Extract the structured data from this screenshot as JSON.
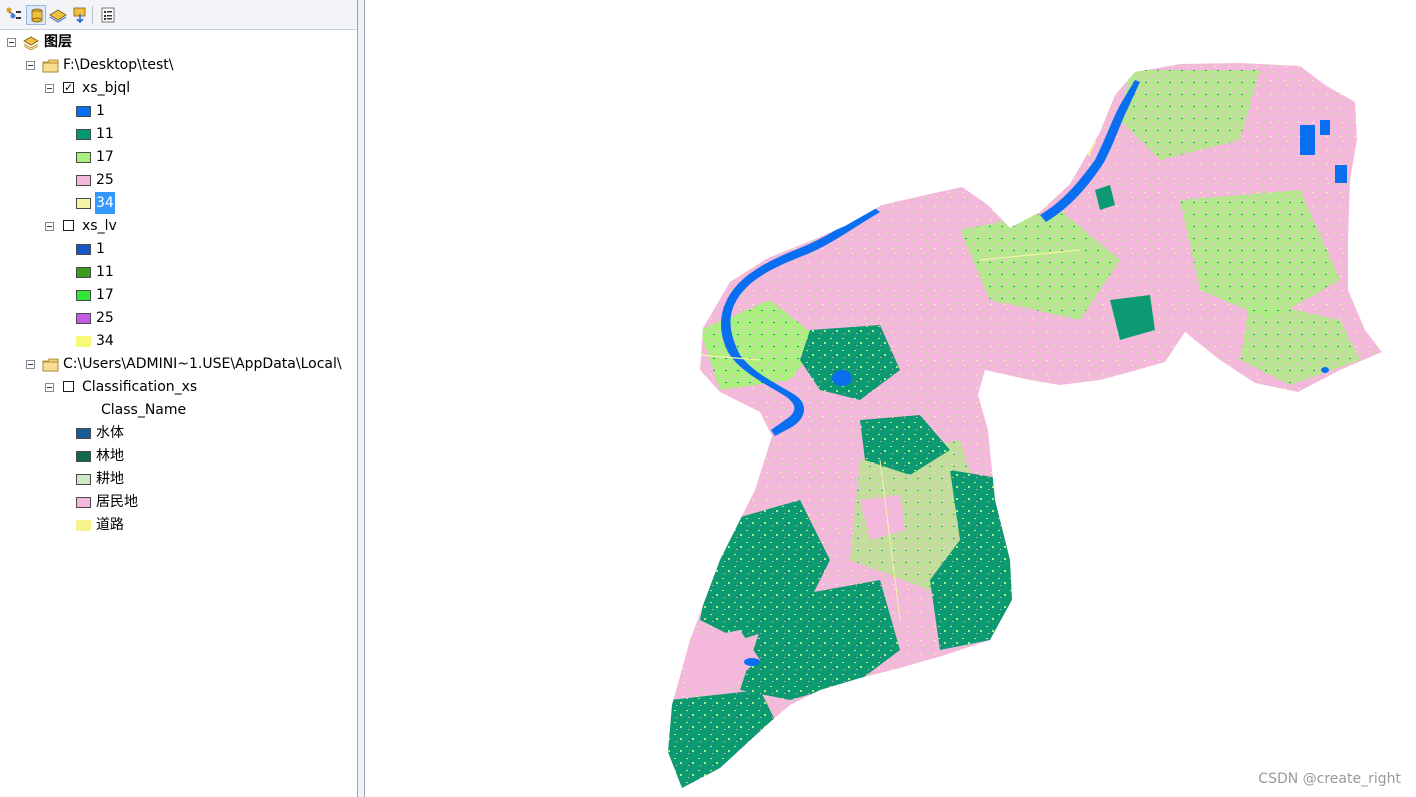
{
  "toolbar": {
    "buttons": [
      {
        "icon": "list-by-drawing-order-icon"
      },
      {
        "icon": "list-by-source-icon"
      },
      {
        "icon": "list-by-visibility-icon"
      },
      {
        "icon": "list-by-selection-icon"
      },
      {
        "icon": "options-icon"
      }
    ]
  },
  "toc": {
    "root": {
      "label": "图层"
    },
    "folder1": {
      "label": "F:\\Desktop\\test\\"
    },
    "layer_bjql": {
      "label": "xs_bjql",
      "checked": true,
      "classes": [
        {
          "label": "1",
          "color": "#0a6ef0"
        },
        {
          "label": "11",
          "color": "#009a72"
        },
        {
          "label": "17",
          "color": "#a9f07e"
        },
        {
          "label": "25",
          "color": "#f5b8dd"
        },
        {
          "label": "34",
          "color": "#f7f2a6",
          "selected": true
        }
      ]
    },
    "layer_lv": {
      "label": "xs_lv",
      "checked": false,
      "classes": [
        {
          "label": "1",
          "color": "#1457c7"
        },
        {
          "label": "11",
          "color": "#3a9a1c"
        },
        {
          "label": "17",
          "color": "#2ee834"
        },
        {
          "label": "25",
          "color": "#c55ae8"
        },
        {
          "label": "34",
          "color": "#f8f87a"
        }
      ]
    },
    "folder2": {
      "label": "C:\\Users\\ADMINI~1.USE\\AppData\\Local\\"
    },
    "layer_cls": {
      "label": "Classification_xs",
      "checked": false,
      "field": "Class_Name",
      "classes": [
        {
          "label": "水体",
          "color": "#185a94"
        },
        {
          "label": "林地",
          "color": "#0f6b45"
        },
        {
          "label": "耕地",
          "color": "#cfe8c4"
        },
        {
          "label": "居民地",
          "color": "#f5b8dd"
        },
        {
          "label": "道路",
          "color": "#f7f28a"
        }
      ]
    }
  },
  "map": {
    "colors": {
      "water": "#0a6ef0",
      "forest": "#0c9a72",
      "farmland": "#a9f07e",
      "residential": "#f5b8dd",
      "road": "#f7f2a6"
    }
  },
  "watermark": "CSDN @create_right"
}
